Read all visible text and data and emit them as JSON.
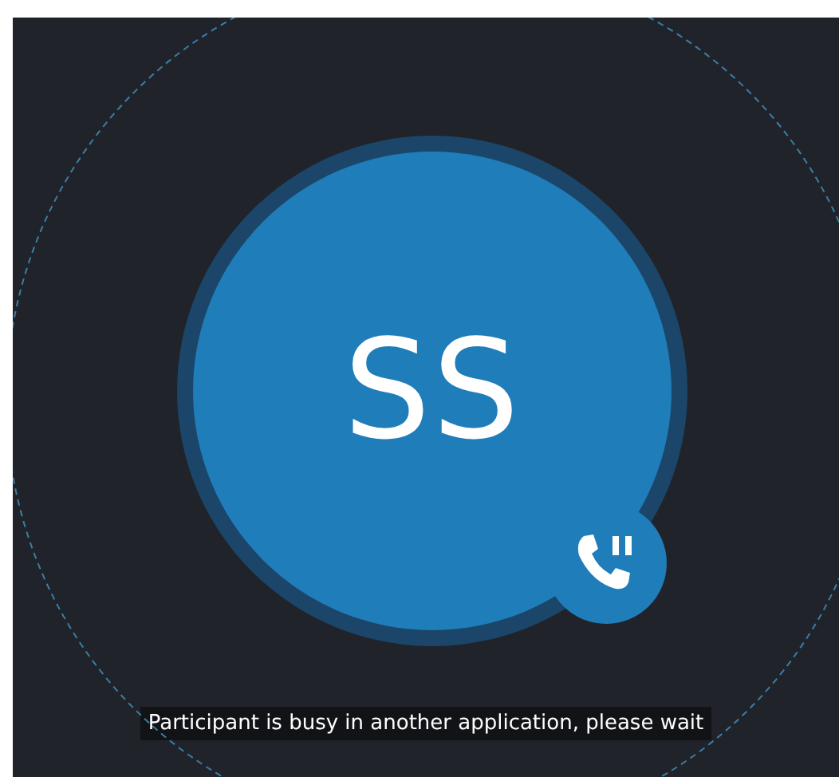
{
  "participant": {
    "initials": "SS",
    "on_hold": true
  },
  "status_message": "Participant is busy in another application, please wait"
}
